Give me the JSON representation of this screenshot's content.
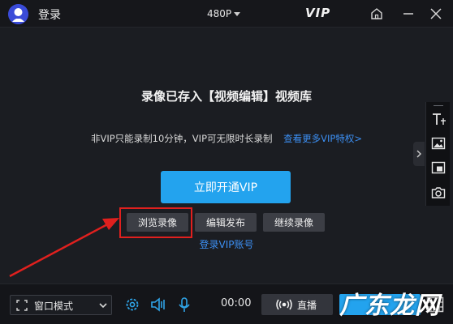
{
  "titlebar": {
    "app_title": "登录",
    "quality": "480P",
    "vip": "VIP"
  },
  "main": {
    "title": "录像已存入【视频编辑】视频库",
    "notice": "非VIP只能录制10分钟，VIP可无限时长录制",
    "notice_link": "查看更多VIP特权>",
    "primary_button": "立即开通VIP",
    "browse_button": "浏览录像",
    "edit_button": "编辑发布",
    "continue_button": "继续录像",
    "login_link": "登录VIP账号"
  },
  "bottombar": {
    "window_mode": "窗口模式",
    "timer": "00:00",
    "live_label": "直播"
  },
  "watermark": "广东龙网",
  "colors": {
    "accent": "#23a3ee",
    "link": "#3c8ff3",
    "highlight": "#e0201e",
    "background": "#1b1d22"
  },
  "icons": {
    "avatar": "user-avatar-icon",
    "home": "home-icon",
    "minimize": "minimize-icon",
    "close": "close-icon",
    "side_tools": [
      "text-icon",
      "image-icon",
      "picture-in-picture-icon",
      "camera-icon"
    ],
    "bottom": [
      "fullscreen-icon",
      "chevron-down-icon",
      "gear-icon",
      "speaker-icon",
      "microphone-icon",
      "live-icon",
      "film-icon"
    ]
  }
}
